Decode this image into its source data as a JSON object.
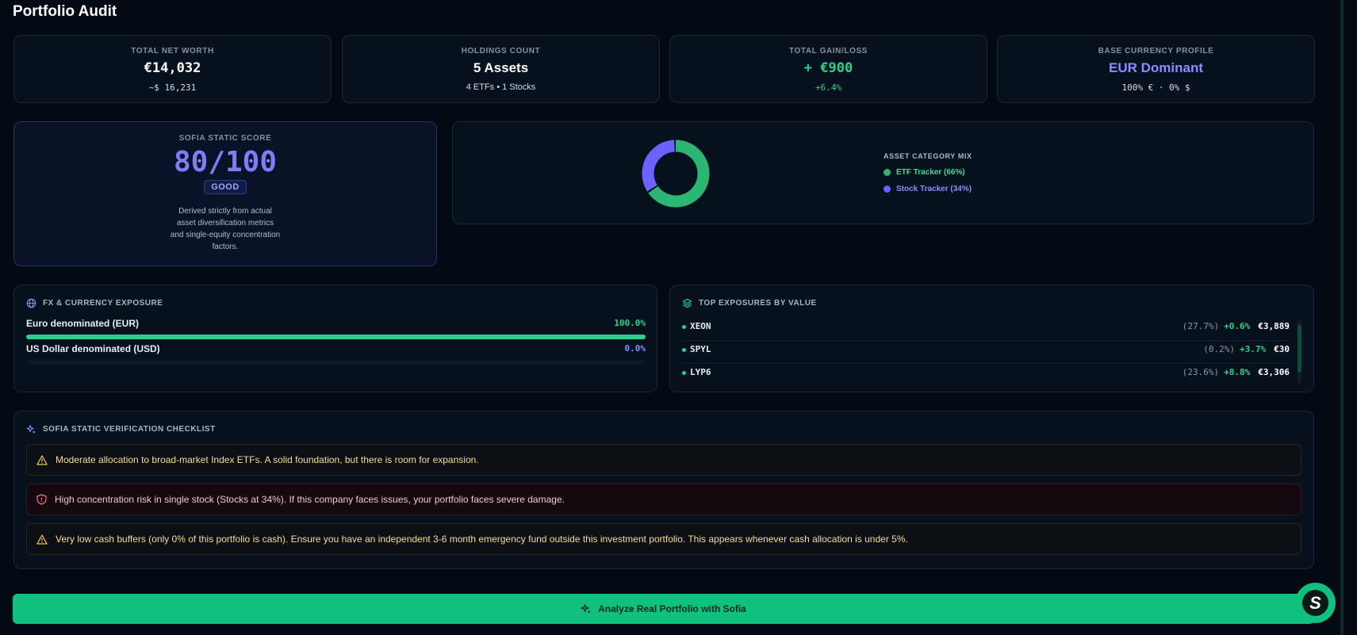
{
  "page": {
    "title": "Portfolio Audit"
  },
  "stats": [
    {
      "label": "TOTAL NET WORTH",
      "value": "€14,032",
      "sub": "~$ 16,231"
    },
    {
      "label": "HOLDINGS COUNT",
      "value": "5 Assets",
      "sub": "4 ETFs • 1 Stocks"
    },
    {
      "label": "TOTAL GAIN/LOSS",
      "value": "+ €900",
      "sub": "+6.4%"
    },
    {
      "label": "BASE CURRENCY PROFILE",
      "value": "EUR Dominant",
      "sub": "100% € · 0% $"
    }
  ],
  "score": {
    "label": "SOFIA STATIC SCORE",
    "value": "80/100",
    "badge": "GOOD",
    "description": "Derived strictly from actual asset diversification metrics and single-equity concentration factors."
  },
  "mix": {
    "label": "ASSET CATEGORY MIX",
    "items": [
      {
        "label": "ETF Tracker (66%)",
        "share": 66,
        "color": "#2bb673"
      },
      {
        "label": "Stock Tracker (34%)",
        "share": 34,
        "color": "#6c63ff"
      }
    ]
  },
  "fx": {
    "heading": "FX & CURRENCY EXPOSURE",
    "rows": [
      {
        "label": "Euro denominated (EUR)",
        "pct": "100.0%",
        "value": 1.0,
        "color": "#2bd18a"
      },
      {
        "label": "US Dollar denominated (USD)",
        "pct": "0.0%",
        "value": 0.0,
        "color": "#6c63ff"
      }
    ]
  },
  "exposures": {
    "heading": "TOP EXPOSURES BY VALUE",
    "rows": [
      {
        "ticker": "XEON",
        "share": "(27.7%)",
        "change": "+0.6%",
        "amount": "€3,889"
      },
      {
        "ticker": "SPYL",
        "share": "(0.2%)",
        "change": "+3.7%",
        "amount": "€30"
      },
      {
        "ticker": "LYP6",
        "share": "(23.6%)",
        "change": "+8.8%",
        "amount": "€3,306"
      }
    ]
  },
  "checklist": {
    "heading": "SOFIA STATIC VERIFICATION CHECKLIST",
    "items": [
      {
        "type": "warning",
        "icon": "warning-icon",
        "text": "Moderate allocation to broad-market Index ETFs. A solid foundation, but there is room for expansion."
      },
      {
        "type": "risk",
        "icon": "shield-alert-icon",
        "text": "High concentration risk in single stock (Stocks at 34%). If this company faces issues, your portfolio faces severe damage."
      },
      {
        "type": "warning",
        "icon": "warning-icon",
        "text": "Very low cash buffers (only 0% of this portfolio is cash). Ensure you have an independent 3-6 month emergency fund outside this investment portfolio. This appears whenever cash allocation is under 5%."
      }
    ]
  },
  "cta": {
    "label": "Analyze Real Portfolio with Sofia",
    "icon": "sparkles-icon"
  },
  "fab": {
    "letter": "S"
  },
  "colors": {
    "accent": "#10c07f",
    "purple": "#7c7ef5",
    "background": "#030a14"
  }
}
